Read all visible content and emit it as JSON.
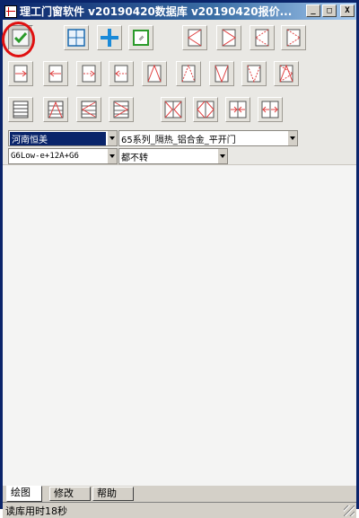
{
  "window": {
    "title": "理工门窗软件 v20190420数据库 v20190420报价...",
    "min_label": "_",
    "max_label": "□",
    "close_label": "X"
  },
  "toolbar": {
    "rows": [
      [
        "check-confirm-icon",
        "grid-split-icon",
        "cross-split-icon",
        "fixed-glass-icon",
        "open-left-icon",
        "open-right-icon",
        "open-left-dashed-icon",
        "open-right-dashed-icon"
      ],
      [
        "slide-right-icon",
        "slide-left-icon",
        "slide-right-dashed-icon",
        "slide-left-dashed-icon",
        "open-top-icon",
        "open-top-dashed-icon",
        "open-bottom-icon",
        "open-bottom-dashed-icon",
        "tilt-turn-icon"
      ],
      [
        "louver-icon",
        "louver-top-icon",
        "louver-left-icon",
        "louver-right-icon",
        "double-open-out-icon",
        "double-open-in-icon",
        "double-slide-in-icon",
        "double-slide-out-icon"
      ]
    ]
  },
  "combos": {
    "brand": "河南恒美",
    "series": "65系列_隔热_铝合金_平开门",
    "glass": "G6Low-e+12A+G6",
    "rotation": "都不转"
  },
  "tabs": [
    "绘图",
    "修改",
    "帮助"
  ],
  "status": "读库用时18秒",
  "colors": {
    "accent_red": "#e01010",
    "check_green": "#2a9a2a",
    "blue_cross": "#1a8ad8",
    "line_red": "#e04040"
  }
}
